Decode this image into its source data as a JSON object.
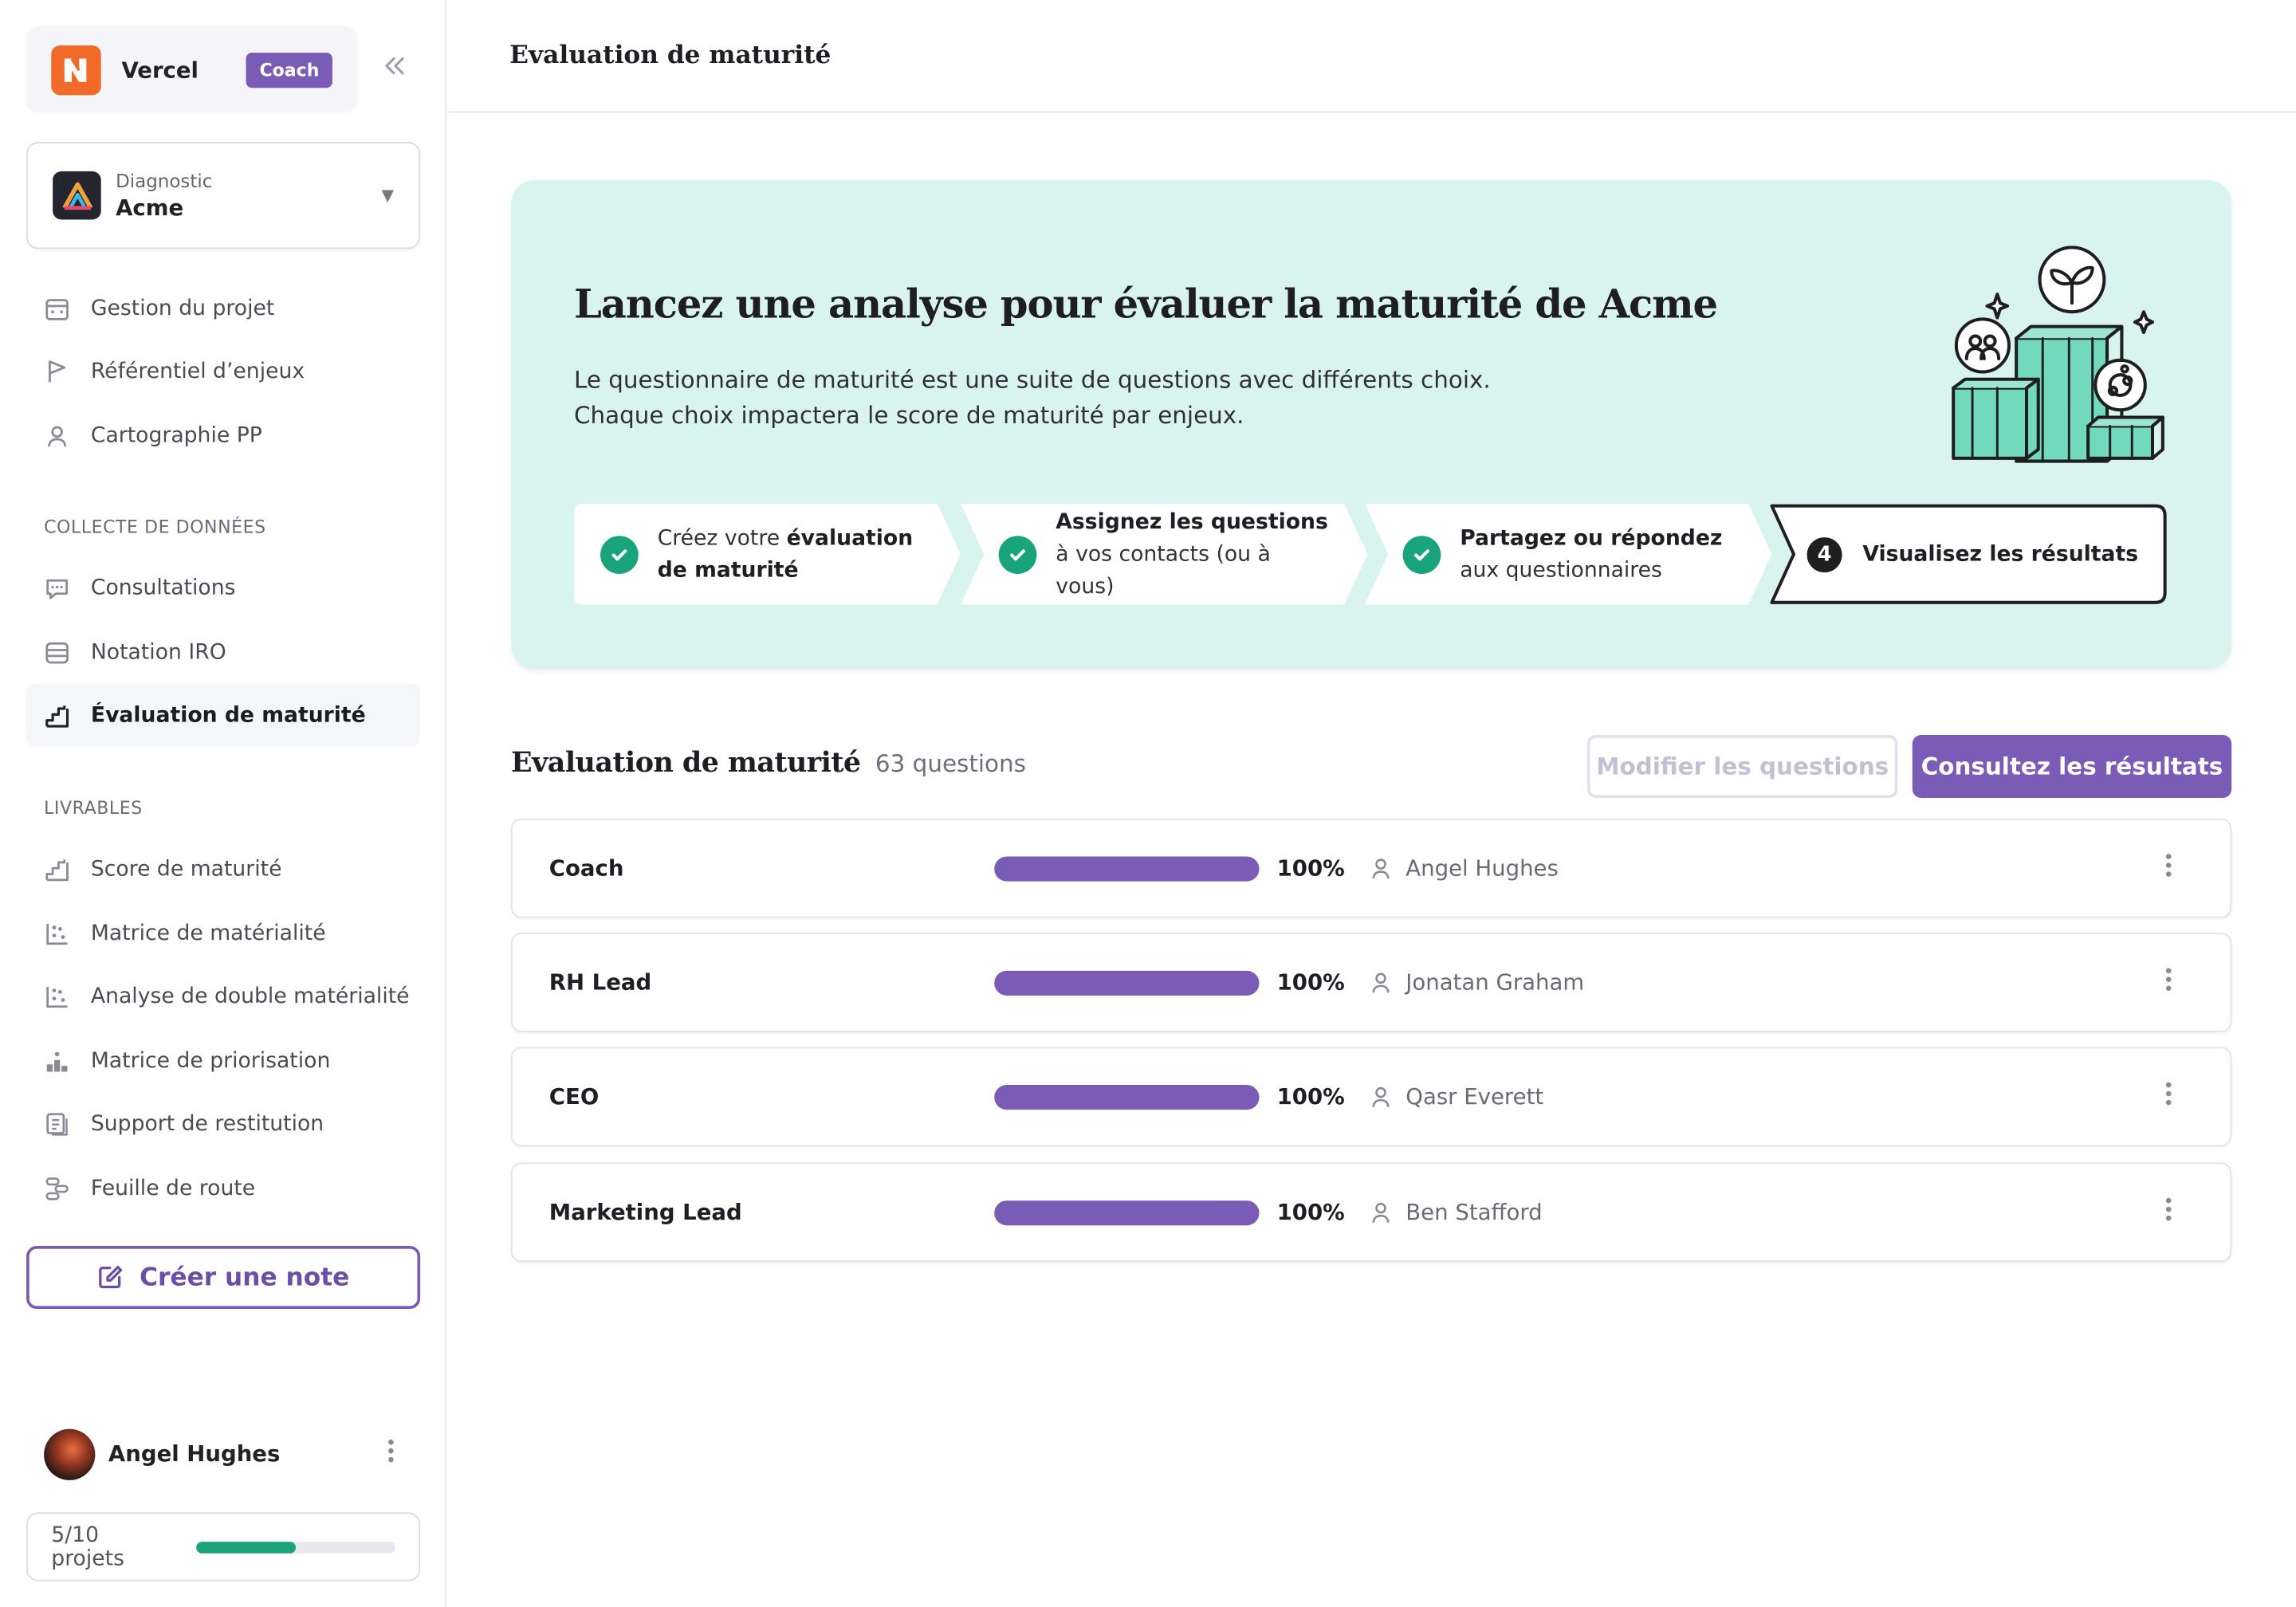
{
  "org": {
    "name": "Vercel",
    "badge": "Coach"
  },
  "diagnostic": {
    "label": "Diagnostic",
    "name": "Acme"
  },
  "nav": {
    "top": [
      {
        "label": "Gestion du projet",
        "icon": "calendar-icon"
      },
      {
        "label": "Référentiel d’enjeux",
        "icon": "flag-icon"
      },
      {
        "label": "Cartographie PP",
        "icon": "user-icon"
      }
    ],
    "section_collecte": "Collecte de données",
    "collecte": [
      {
        "label": "Consultations",
        "icon": "chat-icon"
      },
      {
        "label": "Notation IRO",
        "icon": "table-icon"
      },
      {
        "label": "Évaluation de maturité",
        "icon": "stairs-icon",
        "active": true
      }
    ],
    "section_livrables": "Livrables",
    "livrables": [
      {
        "label": "Score de maturité",
        "icon": "stairs-icon"
      },
      {
        "label": "Matrice de matérialité",
        "icon": "scatter-icon"
      },
      {
        "label": "Analyse de double matérialité",
        "icon": "scatter-icon"
      },
      {
        "label": "Matrice de priorisation",
        "icon": "podium-icon"
      },
      {
        "label": "Support de restitution",
        "icon": "document-icon"
      },
      {
        "label": "Feuille de route",
        "icon": "route-icon"
      }
    ]
  },
  "create_note": "Créer une note",
  "user": {
    "name": "Angel Hughes"
  },
  "quota": {
    "label": "5/10 projets",
    "used": 5,
    "total": 10
  },
  "page": {
    "title": "Evaluation de maturité"
  },
  "hero": {
    "title": "Lancez une analyse pour évaluer la maturité de Acme",
    "desc_line1": "Le questionnaire de maturité est une suite de questions avec différents choix.",
    "desc_line2": "Chaque choix impactera le score de maturité par enjeux."
  },
  "steps": [
    {
      "pre": "Créez votre ",
      "bold": "évaluation de maturité",
      "post": "",
      "done": true
    },
    {
      "pre": "",
      "bold": "Assignez les questions",
      "post": " à vos contacts (ou à vous)",
      "done": true
    },
    {
      "pre": "",
      "bold": "Partagez ou répondez",
      "post": " aux questionnaires",
      "done": true
    },
    {
      "number": "4",
      "bold": "Visualisez les résultats",
      "done": false
    }
  ],
  "list": {
    "title": "Evaluation de maturité",
    "count": "63 questions",
    "edit_button": "Modifier les questions",
    "results_button": "Consultez les résultats",
    "rows": [
      {
        "name": "Coach",
        "progress": 100,
        "pct": "100%",
        "person": "Angel Hughes"
      },
      {
        "name": "RH Lead",
        "progress": 100,
        "pct": "100%",
        "person": "Jonatan Graham"
      },
      {
        "name": "CEO",
        "progress": 100,
        "pct": "100%",
        "person": "Qasr Everett"
      },
      {
        "name": "Marketing Lead",
        "progress": 100,
        "pct": "100%",
        "person": "Ben Stafford"
      }
    ]
  },
  "colors": {
    "accent": "#7a5bb5",
    "success": "#19a47c",
    "hero_bg": "#d9f4ee",
    "org_logo": "#f26a28"
  }
}
